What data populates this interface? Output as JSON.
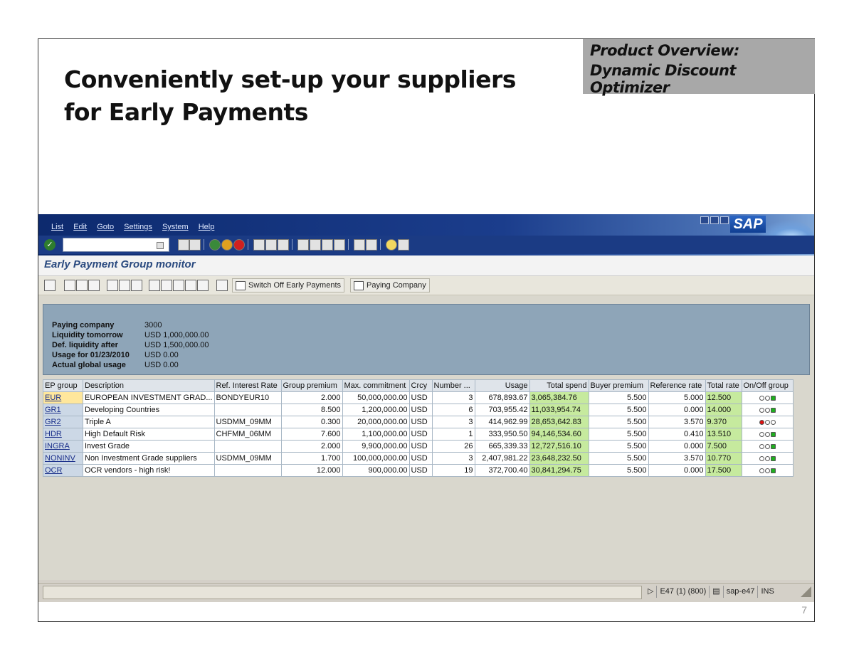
{
  "slide": {
    "title_line1": "Conveniently set-up your suppliers",
    "title_line2": "for Early Payments",
    "product_line1": "Product Overview:",
    "product_line2": "Dynamic Discount Optimizer",
    "page_number": "7"
  },
  "sap": {
    "logo": "SAP",
    "menu": [
      "List",
      "Edit",
      "Goto",
      "Settings",
      "System",
      "Help"
    ],
    "screen_title": "Early Payment Group monitor",
    "buttons": {
      "switch_off": "Switch Off Early Payments",
      "paying_company": "Paying Company"
    },
    "header_panel": [
      {
        "label": "Paying company",
        "value": "3000"
      },
      {
        "label": "Liquidity tomorrow",
        "value": "USD 1,000,000.00"
      },
      {
        "label": "Def. liquidity after",
        "value": "USD 1,500,000.00"
      },
      {
        "label": "Usage for 01/23/2010",
        "value": "USD 0.00"
      },
      {
        "label": "Actual global usage",
        "value": "USD 0.00"
      }
    ],
    "table": {
      "columns": [
        "EP group",
        "Description",
        "Ref. Interest Rate",
        "Group premium",
        "Max. commitment",
        "Crcy",
        "Number ...",
        "Usage",
        "Total spend",
        "Buyer premium",
        "Reference rate",
        "Total rate",
        "On/Off group"
      ],
      "rows": [
        {
          "group": "EUR",
          "description": "EUROPEAN INVESTMENT GRAD...",
          "ref_rate": "BONDYEUR10",
          "group_premium": "2.000",
          "max_commitment": "50,000,000.00",
          "crcy": "USD",
          "number": "3",
          "usage": "678,893.67",
          "total_spend": "3,065,384.76",
          "buyer_premium": "5.500",
          "reference_rate": "5.000",
          "total_rate": "12.500",
          "status": "on"
        },
        {
          "group": "GR1",
          "description": "Developing Countries",
          "ref_rate": "",
          "group_premium": "8.500",
          "max_commitment": "1,200,000.00",
          "crcy": "USD",
          "number": "6",
          "usage": "703,955.42",
          "total_spend": "11,033,954.74",
          "buyer_premium": "5.500",
          "reference_rate": "0.000",
          "total_rate": "14.000",
          "status": "on"
        },
        {
          "group": "GR2",
          "description": "Triple A",
          "ref_rate": "USDMM_09MM",
          "group_premium": "0.300",
          "max_commitment": "20,000,000.00",
          "crcy": "USD",
          "number": "3",
          "usage": "414,962.99",
          "total_spend": "28,653,642.83",
          "buyer_premium": "5.500",
          "reference_rate": "3.570",
          "total_rate": "9.370",
          "status": "off"
        },
        {
          "group": "HDR",
          "description": "High Default Risk",
          "ref_rate": "CHFMM_06MM",
          "group_premium": "7.600",
          "max_commitment": "1,100,000.00",
          "crcy": "USD",
          "number": "1",
          "usage": "333,950.50",
          "total_spend": "94,146,534.60",
          "buyer_premium": "5.500",
          "reference_rate": "0.410",
          "total_rate": "13.510",
          "status": "on"
        },
        {
          "group": "INGRA",
          "description": "Invest Grade",
          "ref_rate": "",
          "group_premium": "2.000",
          "max_commitment": "9,900,000.00",
          "crcy": "USD",
          "number": "26",
          "usage": "665,339.33",
          "total_spend": "12,727,516.10",
          "buyer_premium": "5.500",
          "reference_rate": "0.000",
          "total_rate": "7.500",
          "status": "on"
        },
        {
          "group": "NONINV",
          "description": "Non Investment Grade suppliers",
          "ref_rate": "USDMM_09MM",
          "group_premium": "1.700",
          "max_commitment": "100,000,000.00",
          "crcy": "USD",
          "number": "3",
          "usage": "2,407,981.22",
          "total_spend": "23,648,232.50",
          "buyer_premium": "5.500",
          "reference_rate": "3.570",
          "total_rate": "10.770",
          "status": "on"
        },
        {
          "group": "OCR",
          "description": "OCR vendors - high risk!",
          "ref_rate": "",
          "group_premium": "12.000",
          "max_commitment": "900,000.00",
          "crcy": "USD",
          "number": "19",
          "usage": "372,700.40",
          "total_spend": "30,841,294.75",
          "buyer_premium": "5.500",
          "reference_rate": "0.000",
          "total_rate": "17.500",
          "status": "on"
        }
      ]
    },
    "status_bar": {
      "system": "E47 (1) (800)",
      "server": "sap-e47",
      "mode": "INS"
    },
    "colors": {
      "title_bar": "#1b3b84",
      "header_panel": "#8ea5b8",
      "highlight_green": "#c6ea9e",
      "lamp_green": "#1fae1f",
      "lamp_red": "#e01010"
    }
  }
}
